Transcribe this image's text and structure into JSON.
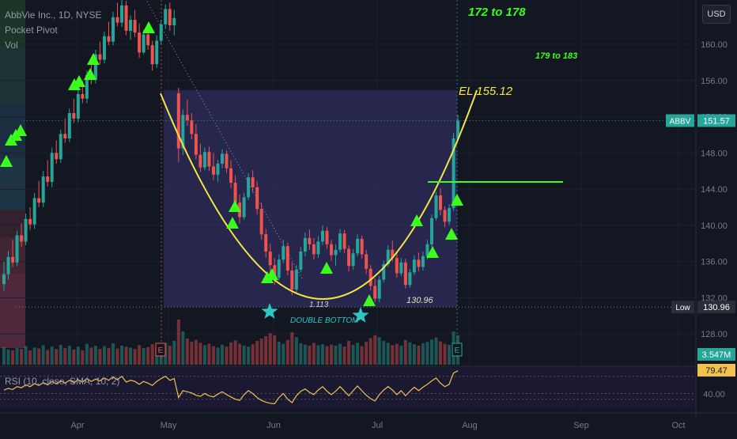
{
  "symbol": {
    "title": "AbbVie Inc., 1D, NYSE",
    "indicator_pocket_pivot": "Pocket Pivot",
    "indicator_vol": "Vol",
    "rsi_label": "RSI (10, close, SMA, 10, 2)"
  },
  "currency_button": "USD",
  "colors": {
    "background": "#131722",
    "up": "#26a69a",
    "down": "#ef5350",
    "cup": "#f5e642",
    "marker": "#3bff1b",
    "star": "#2ec7c2",
    "rsi": "#f2c14e",
    "pattern_box": "#2d2b57"
  },
  "chart_data": {
    "type": "candlestick",
    "x_ticks": [
      "Apr",
      "May",
      "Jun",
      "Jul",
      "Aug",
      "Sep",
      "Oct"
    ],
    "y_ticks": [
      "160.00",
      "156.00",
      "152.00",
      "148.00",
      "144.00",
      "140.00",
      "136.00",
      "132.00",
      "128.00"
    ],
    "ylim": [
      124.6,
      164.9
    ],
    "price_tags": [
      {
        "label": "ABBV",
        "value": "151.57",
        "color": "#26a69a"
      },
      {
        "label": "Low",
        "value": "130.96",
        "color": "#2a2e39"
      },
      {
        "label": "",
        "value": "3.547M",
        "color": "#26a69a"
      },
      {
        "label": "",
        "value": "79.47",
        "color": "#f2c14e"
      }
    ],
    "rsi_ticks": [
      "40.00"
    ],
    "annotations": {
      "target_1": "172 to 178",
      "target_2": "179 to 183",
      "entry": "EL 155.12",
      "low_value": "130.96",
      "small_value": "1.113",
      "pattern": "DOUBLE BOTTOM"
    },
    "earnings_marker": "E",
    "candles": [
      [
        133.5,
        136.0,
        132.8,
        134.6
      ],
      [
        134.6,
        137.2,
        134.0,
        136.5
      ],
      [
        136.5,
        138.4,
        135.4,
        135.9
      ],
      [
        135.9,
        139.4,
        135.5,
        138.9
      ],
      [
        138.9,
        140.2,
        137.6,
        138.2
      ],
      [
        138.2,
        141.3,
        137.8,
        140.7
      ],
      [
        140.7,
        142.0,
        139.5,
        140.1
      ],
      [
        140.1,
        143.6,
        139.6,
        143.0
      ],
      [
        143.0,
        144.9,
        142.0,
        142.5
      ],
      [
        142.5,
        146.0,
        142.0,
        145.4
      ],
      [
        145.4,
        147.2,
        144.3,
        144.8
      ],
      [
        144.8,
        148.6,
        144.2,
        148.0
      ],
      [
        148.0,
        149.4,
        146.8,
        147.3
      ],
      [
        147.3,
        150.6,
        146.9,
        150.1
      ],
      [
        150.1,
        151.8,
        149.1,
        149.6
      ],
      [
        149.6,
        152.9,
        149.2,
        152.4
      ],
      [
        152.4,
        154.0,
        151.3,
        151.8
      ],
      [
        151.8,
        155.0,
        151.4,
        154.5
      ],
      [
        154.5,
        156.0,
        153.5,
        154.0
      ],
      [
        154.0,
        157.1,
        153.5,
        156.6
      ],
      [
        156.6,
        158.3,
        155.6,
        156.1
      ],
      [
        156.1,
        159.4,
        155.7,
        158.9
      ],
      [
        158.9,
        160.3,
        157.8,
        158.3
      ],
      [
        158.3,
        161.4,
        157.9,
        160.9
      ],
      [
        160.9,
        162.5,
        159.9,
        160.3
      ],
      [
        160.3,
        163.6,
        159.9,
        163.0
      ],
      [
        163.0,
        164.6,
        162.0,
        162.4
      ],
      [
        162.4,
        164.9,
        161.9,
        164.3
      ],
      [
        164.3,
        164.8,
        161.0,
        161.5
      ],
      [
        161.5,
        163.2,
        160.5,
        162.7
      ],
      [
        162.7,
        163.8,
        160.8,
        161.3
      ],
      [
        161.3,
        162.3,
        158.5,
        159.1
      ],
      [
        159.1,
        161.6,
        158.9,
        161.1
      ],
      [
        161.1,
        161.9,
        159.4,
        159.9
      ],
      [
        159.9,
        160.4,
        157.1,
        157.8
      ],
      [
        157.8,
        161.0,
        157.4,
        160.4
      ],
      [
        160.4,
        162.7,
        160.0,
        162.2
      ],
      [
        162.2,
        164.4,
        161.7,
        163.9
      ],
      [
        163.9,
        164.6,
        161.5,
        162.1
      ],
      [
        162.1,
        163.8,
        161.0,
        162.9
      ],
      [
        154.6,
        155.2,
        147.0,
        148.5
      ],
      [
        148.5,
        152.8,
        147.8,
        152.2
      ],
      [
        152.2,
        153.9,
        151.0,
        151.6
      ],
      [
        151.6,
        152.4,
        149.5,
        150.1
      ],
      [
        150.1,
        151.2,
        147.3,
        147.8
      ],
      [
        147.8,
        149.0,
        145.9,
        146.4
      ],
      [
        146.4,
        148.6,
        146.1,
        148.1
      ],
      [
        148.1,
        148.7,
        146.0,
        146.5
      ],
      [
        146.5,
        148.0,
        145.0,
        145.6
      ],
      [
        145.6,
        147.2,
        144.8,
        146.8
      ],
      [
        146.8,
        148.4,
        146.3,
        147.9
      ],
      [
        147.9,
        148.3,
        145.8,
        146.3
      ],
      [
        146.3,
        147.2,
        144.1,
        144.7
      ],
      [
        144.7,
        145.5,
        141.9,
        142.5
      ],
      [
        142.5,
        143.4,
        140.2,
        140.9
      ],
      [
        140.9,
        143.6,
        140.6,
        143.1
      ],
      [
        143.1,
        145.8,
        142.8,
        145.3
      ],
      [
        145.3,
        146.1,
        143.6,
        144.2
      ],
      [
        144.2,
        144.9,
        141.2,
        141.8
      ],
      [
        141.8,
        142.5,
        138.4,
        139.0
      ],
      [
        139.0,
        139.6,
        136.4,
        137.1
      ],
      [
        137.1,
        138.0,
        134.8,
        135.6
      ],
      [
        135.6,
        136.4,
        133.4,
        134.2
      ],
      [
        134.2,
        136.8,
        133.9,
        136.2
      ],
      [
        136.2,
        138.4,
        135.8,
        137.7
      ],
      [
        137.7,
        138.1,
        134.5,
        135.0
      ],
      [
        135.0,
        135.9,
        132.3,
        132.9
      ],
      [
        132.9,
        135.6,
        132.6,
        135.1
      ],
      [
        135.1,
        137.6,
        134.8,
        137.1
      ],
      [
        137.1,
        139.2,
        136.6,
        138.6
      ],
      [
        138.6,
        139.5,
        137.3,
        137.9
      ],
      [
        137.9,
        138.6,
        136.2,
        136.8
      ],
      [
        136.8,
        138.8,
        136.4,
        138.2
      ],
      [
        138.2,
        140.0,
        137.8,
        139.4
      ],
      [
        139.4,
        139.8,
        137.4,
        137.9
      ],
      [
        137.9,
        138.4,
        136.1,
        136.7
      ],
      [
        136.7,
        137.9,
        135.5,
        137.3
      ],
      [
        137.3,
        139.6,
        137.0,
        139.1
      ],
      [
        139.1,
        139.5,
        136.9,
        137.4
      ],
      [
        137.4,
        137.8,
        134.9,
        135.5
      ],
      [
        135.5,
        137.4,
        135.1,
        136.9
      ],
      [
        136.9,
        139.0,
        136.6,
        138.5
      ],
      [
        138.5,
        138.9,
        136.3,
        136.8
      ],
      [
        136.8,
        137.3,
        134.6,
        135.2
      ],
      [
        135.2,
        135.6,
        132.8,
        133.3
      ],
      [
        133.3,
        134.1,
        131.5,
        131.9
      ],
      [
        131.9,
        134.4,
        131.5,
        134.0
      ],
      [
        134.0,
        136.1,
        133.7,
        135.7
      ],
      [
        135.7,
        137.8,
        135.4,
        137.3
      ],
      [
        137.3,
        138.3,
        136.0,
        136.4
      ],
      [
        136.4,
        136.9,
        134.2,
        134.7
      ],
      [
        134.7,
        136.4,
        134.4,
        135.9
      ],
      [
        135.9,
        136.3,
        133.0,
        133.4
      ],
      [
        133.4,
        135.2,
        133.1,
        134.8
      ],
      [
        134.8,
        136.7,
        134.5,
        136.2
      ],
      [
        136.2,
        137.0,
        134.9,
        135.4
      ],
      [
        135.4,
        137.1,
        135.0,
        136.6
      ],
      [
        136.6,
        138.4,
        136.2,
        137.9
      ],
      [
        137.9,
        141.2,
        137.6,
        140.8
      ],
      [
        140.8,
        143.7,
        140.5,
        143.3
      ],
      [
        143.3,
        144.1,
        141.1,
        141.7
      ],
      [
        141.7,
        142.1,
        139.8,
        140.4
      ],
      [
        140.4,
        142.3,
        140.0,
        141.9
      ],
      [
        141.9,
        150.2,
        141.6,
        149.6
      ],
      [
        149.6,
        152.2,
        149.3,
        151.57
      ]
    ],
    "volumes": [
      0.37,
      0.32,
      0.3,
      0.35,
      0.33,
      0.39,
      0.3,
      0.36,
      0.34,
      0.41,
      0.31,
      0.38,
      0.33,
      0.42,
      0.35,
      0.4,
      0.32,
      0.38,
      0.3,
      0.44,
      0.36,
      0.4,
      0.33,
      0.39,
      0.35,
      0.45,
      0.34,
      0.4,
      0.38,
      0.36,
      0.33,
      0.41,
      0.35,
      0.37,
      0.43,
      0.36,
      0.39,
      0.46,
      0.4,
      0.5,
      0.95,
      0.7,
      0.55,
      0.48,
      0.52,
      0.46,
      0.41,
      0.44,
      0.39,
      0.36,
      0.42,
      0.38,
      0.47,
      0.51,
      0.44,
      0.4,
      0.38,
      0.43,
      0.5,
      0.55,
      0.6,
      0.66,
      0.62,
      0.48,
      0.44,
      0.52,
      0.68,
      0.58,
      0.45,
      0.42,
      0.4,
      0.46,
      0.41,
      0.43,
      0.39,
      0.42,
      0.4,
      0.44,
      0.38,
      0.5,
      0.42,
      0.46,
      0.39,
      0.48,
      0.56,
      0.62,
      0.58,
      0.5,
      0.46,
      0.41,
      0.44,
      0.4,
      0.52,
      0.47,
      0.43,
      0.4,
      0.45,
      0.48,
      0.53,
      0.57,
      0.49,
      0.44,
      0.42,
      0.7,
      0.62
    ],
    "rsi": [
      46,
      49,
      47,
      52,
      50,
      55,
      52,
      57,
      54,
      59,
      55,
      61,
      57,
      62,
      58,
      63,
      59,
      64,
      60,
      66,
      61,
      65,
      62,
      67,
      63,
      69,
      64,
      70,
      60,
      63,
      61,
      56,
      61,
      58,
      54,
      61,
      66,
      70,
      63,
      66,
      33,
      45,
      43,
      41,
      37,
      35,
      40,
      36,
      34,
      39,
      43,
      38,
      34,
      30,
      28,
      38,
      45,
      40,
      33,
      28,
      25,
      23,
      22,
      33,
      40,
      30,
      24,
      36,
      44,
      48,
      42,
      38,
      46,
      52,
      44,
      38,
      44,
      52,
      44,
      36,
      45,
      53,
      45,
      37,
      31,
      27,
      38,
      46,
      52,
      46,
      38,
      45,
      36,
      44,
      51,
      45,
      51,
      56,
      62,
      67,
      58,
      52,
      56,
      76,
      79.47
    ]
  }
}
